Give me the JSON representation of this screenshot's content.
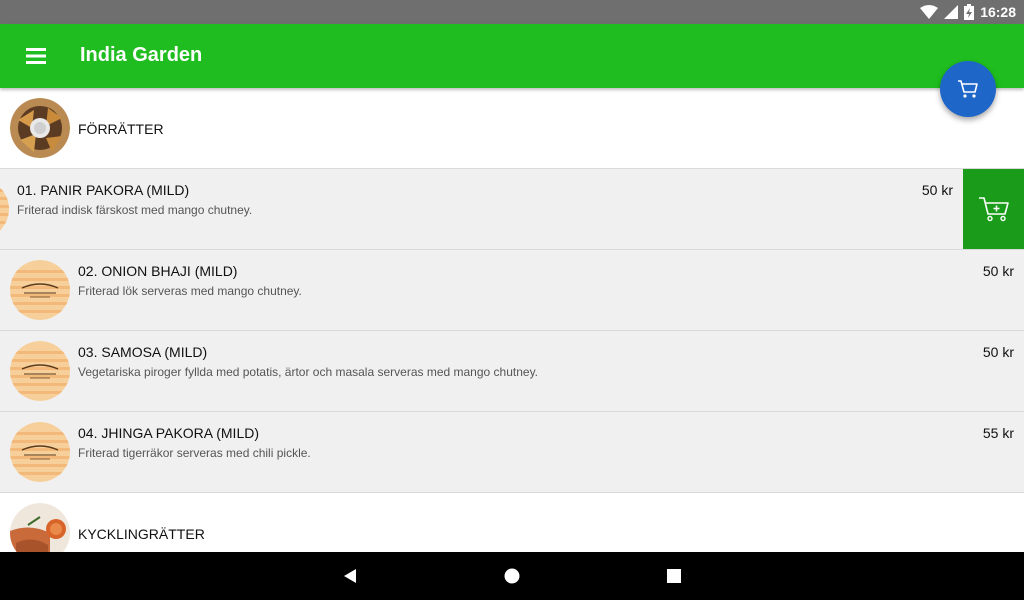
{
  "status_bar": {
    "time": "16:28",
    "icons": [
      "wifi-icon",
      "signal-icon",
      "battery-charging-icon"
    ]
  },
  "app_bar": {
    "title": "India Garden",
    "menu_icon": "hamburger-menu-icon"
  },
  "fab": {
    "icon": "cart-icon",
    "color": "#1e66c8"
  },
  "colors": {
    "app_bar": "#1fbd1f",
    "add_button": "#1a9c1a",
    "status_bar": "#6f6f6f"
  },
  "categories": [
    {
      "label": "FÖRRÄTTER",
      "image": "samosa-plate-image"
    },
    {
      "label": "KYCKLINGRÄTTER",
      "image": "chicken-dish-image"
    }
  ],
  "items": [
    {
      "name": "01. PANIR PAKORA (MILD)",
      "description": "Friterad indisk färskost med mango chutney.",
      "price": "50 kr",
      "image": "india-garden-logo"
    },
    {
      "name": "02. ONION BHAJI (MILD)",
      "description": "Friterad lök serveras med mango chutney.",
      "price": "50 kr",
      "image": "india-garden-logo"
    },
    {
      "name": "03. SAMOSA (MILD)",
      "description": "Vegetariska piroger fyllda med potatis, ärtor och masala serveras med mango chutney.",
      "price": "50 kr",
      "image": "india-garden-logo"
    },
    {
      "name": "04. JHINGA PAKORA (MILD)",
      "description": "Friterad tigerräkor serveras med chili pickle.",
      "price": "55 kr",
      "image": "india-garden-logo"
    }
  ],
  "swiped_item_action": {
    "icon": "add-to-cart-icon"
  },
  "nav_bar": {
    "buttons": [
      "back-icon",
      "home-icon",
      "recents-icon"
    ]
  }
}
